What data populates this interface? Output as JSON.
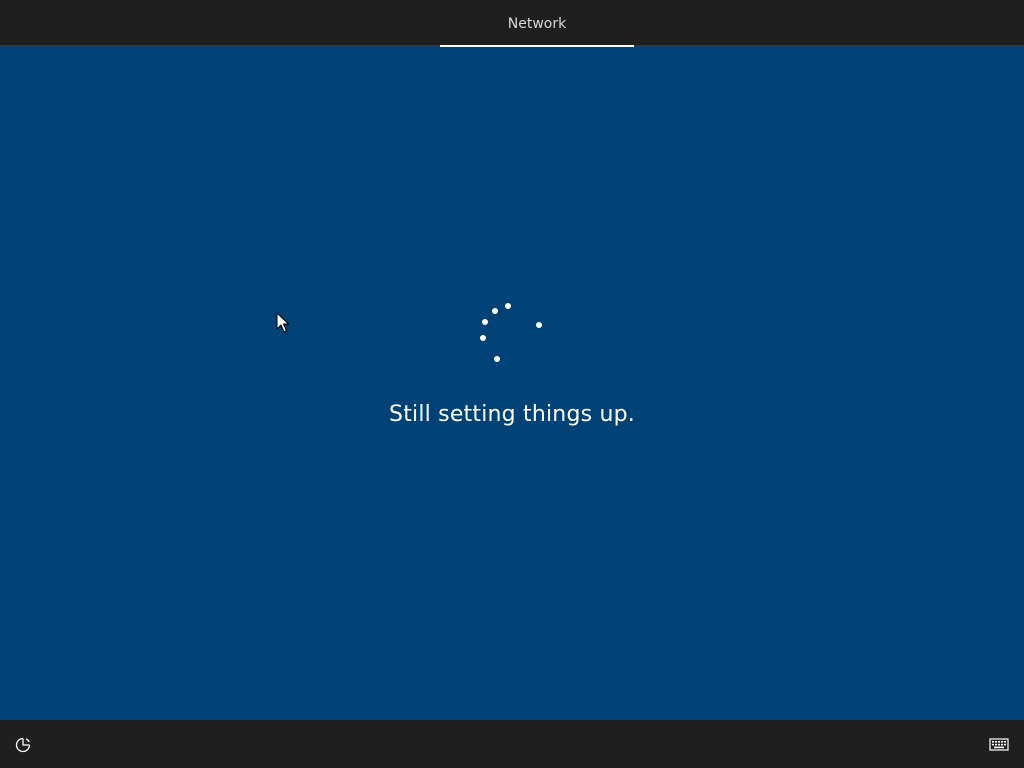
{
  "header": {
    "active_step": "Network"
  },
  "main": {
    "status_message": "Still setting things up."
  },
  "footer": {
    "left_icon": "accessibility-icon",
    "right_icon": "keyboard-icon"
  },
  "colors": {
    "background": "#004275",
    "bars": "#1f1f1f",
    "text": "#ffffff"
  }
}
